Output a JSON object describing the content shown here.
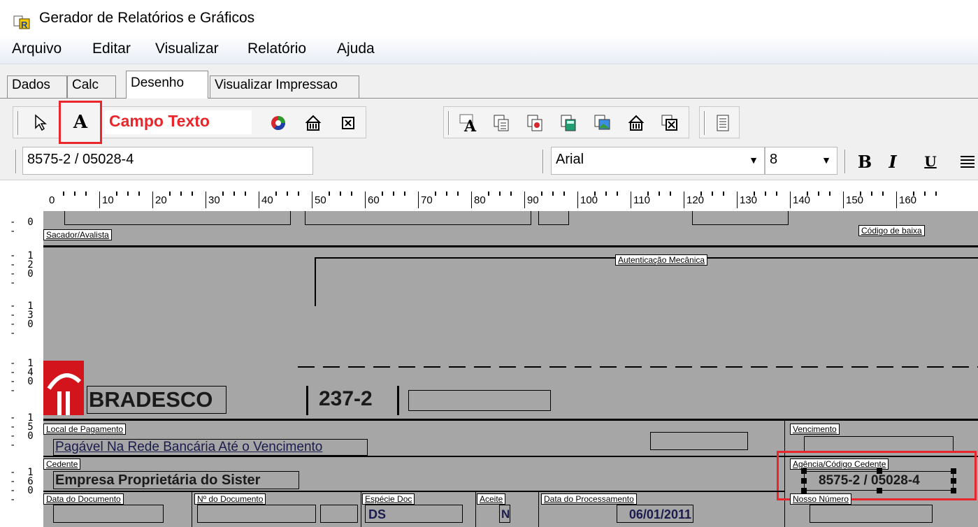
{
  "window": {
    "title": "Gerador de Relatórios e Gráficos",
    "icon": "report-app-icon"
  },
  "menu": [
    "Arquivo",
    "Editar",
    "Visualizar",
    "Relatório",
    "Ajuda"
  ],
  "tabs": [
    {
      "label": "Dados",
      "active": false
    },
    {
      "label": "Calc",
      "active": false
    },
    {
      "label": "Desenho",
      "active": true
    },
    {
      "label": "Visualizar Impressao",
      "active": false
    }
  ],
  "toolbar": {
    "text_field_glyph": "A",
    "annotation": "Campo Texto"
  },
  "format_bar": {
    "field_value": "8575-2 / 05028-4",
    "font_name": "Arial",
    "font_size": "8",
    "bold": "B",
    "italic": "I",
    "underline": "U"
  },
  "ruler": {
    "h_marks": [
      "0",
      "10",
      "20",
      "30",
      "40",
      "50",
      "60",
      "70",
      "80",
      "90",
      "100",
      "110",
      "120",
      "130",
      "140",
      "150",
      "160"
    ],
    "v_marks": [
      "-  0\n-",
      "-  1\n-  2\n-  0\n-",
      "-  1\n-  3\n-  0\n-",
      "-  1\n-  4\n-  0\n-",
      "-  1\n-  5\n-  0\n-",
      "-  1\n-  6\n-  0\n-"
    ]
  },
  "form": {
    "sacador_label": "Sacador/Avalista",
    "codigo_baixa_label": "Código de baixa",
    "autenticacao_label": "Autenticação Mecânica",
    "bank_name": "BRADESCO",
    "bank_code": "237-2",
    "local_pagamento_label": "Local de Pagamento",
    "local_pagamento_value": "Pagável Na Rede Bancária Até o Vencimento",
    "vencimento_label": "Vencimento",
    "cedente_label": "Cedente",
    "cedente_value": "Empresa Proprietária do Sister",
    "agencia_label": "Agência/Código Cedente",
    "agencia_value": "8575-2 / 05028-4",
    "data_documento_label": "Data do Documento",
    "nr_documento_label": "Nº do Documento",
    "especie_doc_label": "Espécie Doc",
    "especie_doc_value": "DS",
    "aceite_label": "Aceite",
    "aceite_value": "N",
    "data_processamento_label": "Data do Processamento",
    "data_processamento_value": "06/01/2011",
    "nosso_numero_label": "Nosso Número"
  },
  "colors": {
    "accent_red": "#e8262c",
    "canvas_gray": "#a6a6a6",
    "bradesco_red": "#d4141c"
  }
}
